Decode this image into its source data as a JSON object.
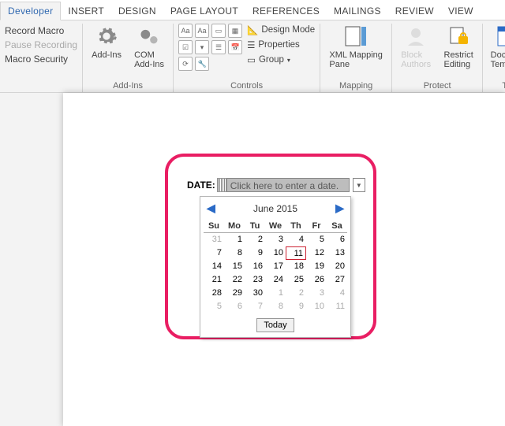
{
  "tabs": {
    "developer": "Developer",
    "insert": "INSERT",
    "design": "DESIGN",
    "page_layout": "PAGE LAYOUT",
    "references": "REFERENCES",
    "mailings": "MAILINGS",
    "review": "REVIEW",
    "view": "VIEW"
  },
  "groups": {
    "addins": "Add-Ins",
    "controls": "Controls",
    "mapping": "Mapping",
    "protect": "Protect",
    "templates": "Te"
  },
  "code": {
    "record": "Record Macro",
    "pause": "Pause Recording",
    "security": "Macro Security"
  },
  "buttons": {
    "addins": "Add-Ins",
    "com": "COM\nAdd-Ins",
    "design_mode": "Design Mode",
    "properties": "Properties",
    "group": "Group",
    "xml": "XML Mapping\nPane",
    "block": "Block\nAuthors",
    "restrict": "Restrict\nEditing",
    "templ": "Docume\nTempla"
  },
  "doc": {
    "label": "DATE:",
    "placeholder": "Click here to enter a date.",
    "calendar": {
      "month": "June 2015",
      "days": [
        "Su",
        "Mo",
        "Tu",
        "We",
        "Th",
        "Fr",
        "Sa"
      ],
      "grid": [
        [
          {
            "n": "31",
            "dim": true
          },
          {
            "n": "1"
          },
          {
            "n": "2"
          },
          {
            "n": "3"
          },
          {
            "n": "4"
          },
          {
            "n": "5"
          },
          {
            "n": "6"
          }
        ],
        [
          {
            "n": "7"
          },
          {
            "n": "8"
          },
          {
            "n": "9"
          },
          {
            "n": "10"
          },
          {
            "n": "11",
            "today": true
          },
          {
            "n": "12"
          },
          {
            "n": "13"
          }
        ],
        [
          {
            "n": "14"
          },
          {
            "n": "15"
          },
          {
            "n": "16"
          },
          {
            "n": "17"
          },
          {
            "n": "18"
          },
          {
            "n": "19"
          },
          {
            "n": "20"
          }
        ],
        [
          {
            "n": "21"
          },
          {
            "n": "22"
          },
          {
            "n": "23"
          },
          {
            "n": "24"
          },
          {
            "n": "25"
          },
          {
            "n": "26"
          },
          {
            "n": "27"
          }
        ],
        [
          {
            "n": "28"
          },
          {
            "n": "29"
          },
          {
            "n": "30"
          },
          {
            "n": "1",
            "dim": true
          },
          {
            "n": "2",
            "dim": true
          },
          {
            "n": "3",
            "dim": true
          },
          {
            "n": "4",
            "dim": true
          }
        ],
        [
          {
            "n": "5",
            "dim": true
          },
          {
            "n": "6",
            "dim": true
          },
          {
            "n": "7",
            "dim": true
          },
          {
            "n": "8",
            "dim": true
          },
          {
            "n": "9",
            "dim": true
          },
          {
            "n": "10",
            "dim": true
          },
          {
            "n": "11",
            "dim": true
          }
        ]
      ],
      "today_btn": "Today"
    }
  }
}
